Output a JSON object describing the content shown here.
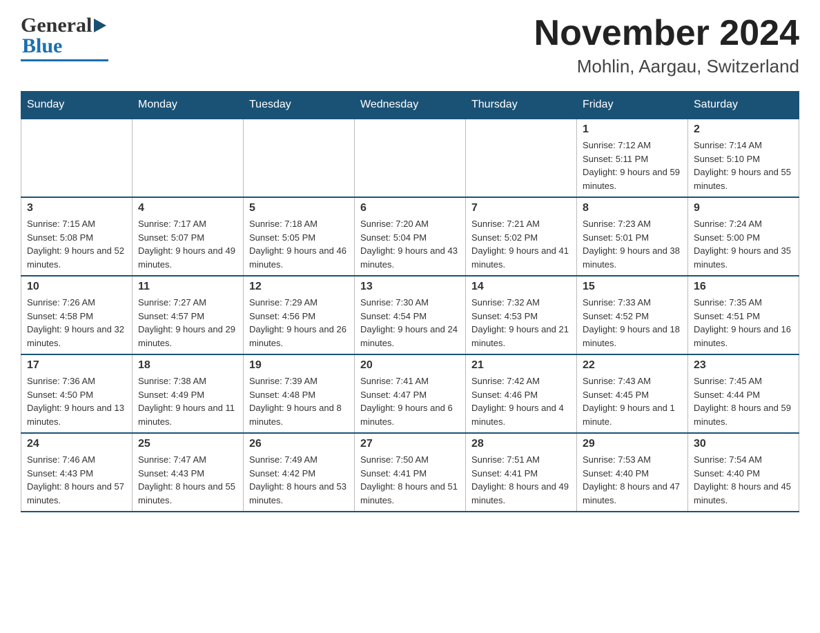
{
  "logo": {
    "general": "General",
    "blue": "Blue",
    "arrow": "▶"
  },
  "header": {
    "title": "November 2024",
    "subtitle": "Mohlin, Aargau, Switzerland"
  },
  "weekdays": [
    "Sunday",
    "Monday",
    "Tuesday",
    "Wednesday",
    "Thursday",
    "Friday",
    "Saturday"
  ],
  "weeks": [
    [
      {
        "day": "",
        "info": ""
      },
      {
        "day": "",
        "info": ""
      },
      {
        "day": "",
        "info": ""
      },
      {
        "day": "",
        "info": ""
      },
      {
        "day": "",
        "info": ""
      },
      {
        "day": "1",
        "info": "Sunrise: 7:12 AM\nSunset: 5:11 PM\nDaylight: 9 hours and 59 minutes."
      },
      {
        "day": "2",
        "info": "Sunrise: 7:14 AM\nSunset: 5:10 PM\nDaylight: 9 hours and 55 minutes."
      }
    ],
    [
      {
        "day": "3",
        "info": "Sunrise: 7:15 AM\nSunset: 5:08 PM\nDaylight: 9 hours and 52 minutes."
      },
      {
        "day": "4",
        "info": "Sunrise: 7:17 AM\nSunset: 5:07 PM\nDaylight: 9 hours and 49 minutes."
      },
      {
        "day": "5",
        "info": "Sunrise: 7:18 AM\nSunset: 5:05 PM\nDaylight: 9 hours and 46 minutes."
      },
      {
        "day": "6",
        "info": "Sunrise: 7:20 AM\nSunset: 5:04 PM\nDaylight: 9 hours and 43 minutes."
      },
      {
        "day": "7",
        "info": "Sunrise: 7:21 AM\nSunset: 5:02 PM\nDaylight: 9 hours and 41 minutes."
      },
      {
        "day": "8",
        "info": "Sunrise: 7:23 AM\nSunset: 5:01 PM\nDaylight: 9 hours and 38 minutes."
      },
      {
        "day": "9",
        "info": "Sunrise: 7:24 AM\nSunset: 5:00 PM\nDaylight: 9 hours and 35 minutes."
      }
    ],
    [
      {
        "day": "10",
        "info": "Sunrise: 7:26 AM\nSunset: 4:58 PM\nDaylight: 9 hours and 32 minutes."
      },
      {
        "day": "11",
        "info": "Sunrise: 7:27 AM\nSunset: 4:57 PM\nDaylight: 9 hours and 29 minutes."
      },
      {
        "day": "12",
        "info": "Sunrise: 7:29 AM\nSunset: 4:56 PM\nDaylight: 9 hours and 26 minutes."
      },
      {
        "day": "13",
        "info": "Sunrise: 7:30 AM\nSunset: 4:54 PM\nDaylight: 9 hours and 24 minutes."
      },
      {
        "day": "14",
        "info": "Sunrise: 7:32 AM\nSunset: 4:53 PM\nDaylight: 9 hours and 21 minutes."
      },
      {
        "day": "15",
        "info": "Sunrise: 7:33 AM\nSunset: 4:52 PM\nDaylight: 9 hours and 18 minutes."
      },
      {
        "day": "16",
        "info": "Sunrise: 7:35 AM\nSunset: 4:51 PM\nDaylight: 9 hours and 16 minutes."
      }
    ],
    [
      {
        "day": "17",
        "info": "Sunrise: 7:36 AM\nSunset: 4:50 PM\nDaylight: 9 hours and 13 minutes."
      },
      {
        "day": "18",
        "info": "Sunrise: 7:38 AM\nSunset: 4:49 PM\nDaylight: 9 hours and 11 minutes."
      },
      {
        "day": "19",
        "info": "Sunrise: 7:39 AM\nSunset: 4:48 PM\nDaylight: 9 hours and 8 minutes."
      },
      {
        "day": "20",
        "info": "Sunrise: 7:41 AM\nSunset: 4:47 PM\nDaylight: 9 hours and 6 minutes."
      },
      {
        "day": "21",
        "info": "Sunrise: 7:42 AM\nSunset: 4:46 PM\nDaylight: 9 hours and 4 minutes."
      },
      {
        "day": "22",
        "info": "Sunrise: 7:43 AM\nSunset: 4:45 PM\nDaylight: 9 hours and 1 minute."
      },
      {
        "day": "23",
        "info": "Sunrise: 7:45 AM\nSunset: 4:44 PM\nDaylight: 8 hours and 59 minutes."
      }
    ],
    [
      {
        "day": "24",
        "info": "Sunrise: 7:46 AM\nSunset: 4:43 PM\nDaylight: 8 hours and 57 minutes."
      },
      {
        "day": "25",
        "info": "Sunrise: 7:47 AM\nSunset: 4:43 PM\nDaylight: 8 hours and 55 minutes."
      },
      {
        "day": "26",
        "info": "Sunrise: 7:49 AM\nSunset: 4:42 PM\nDaylight: 8 hours and 53 minutes."
      },
      {
        "day": "27",
        "info": "Sunrise: 7:50 AM\nSunset: 4:41 PM\nDaylight: 8 hours and 51 minutes."
      },
      {
        "day": "28",
        "info": "Sunrise: 7:51 AM\nSunset: 4:41 PM\nDaylight: 8 hours and 49 minutes."
      },
      {
        "day": "29",
        "info": "Sunrise: 7:53 AM\nSunset: 4:40 PM\nDaylight: 8 hours and 47 minutes."
      },
      {
        "day": "30",
        "info": "Sunrise: 7:54 AM\nSunset: 4:40 PM\nDaylight: 8 hours and 45 minutes."
      }
    ]
  ]
}
